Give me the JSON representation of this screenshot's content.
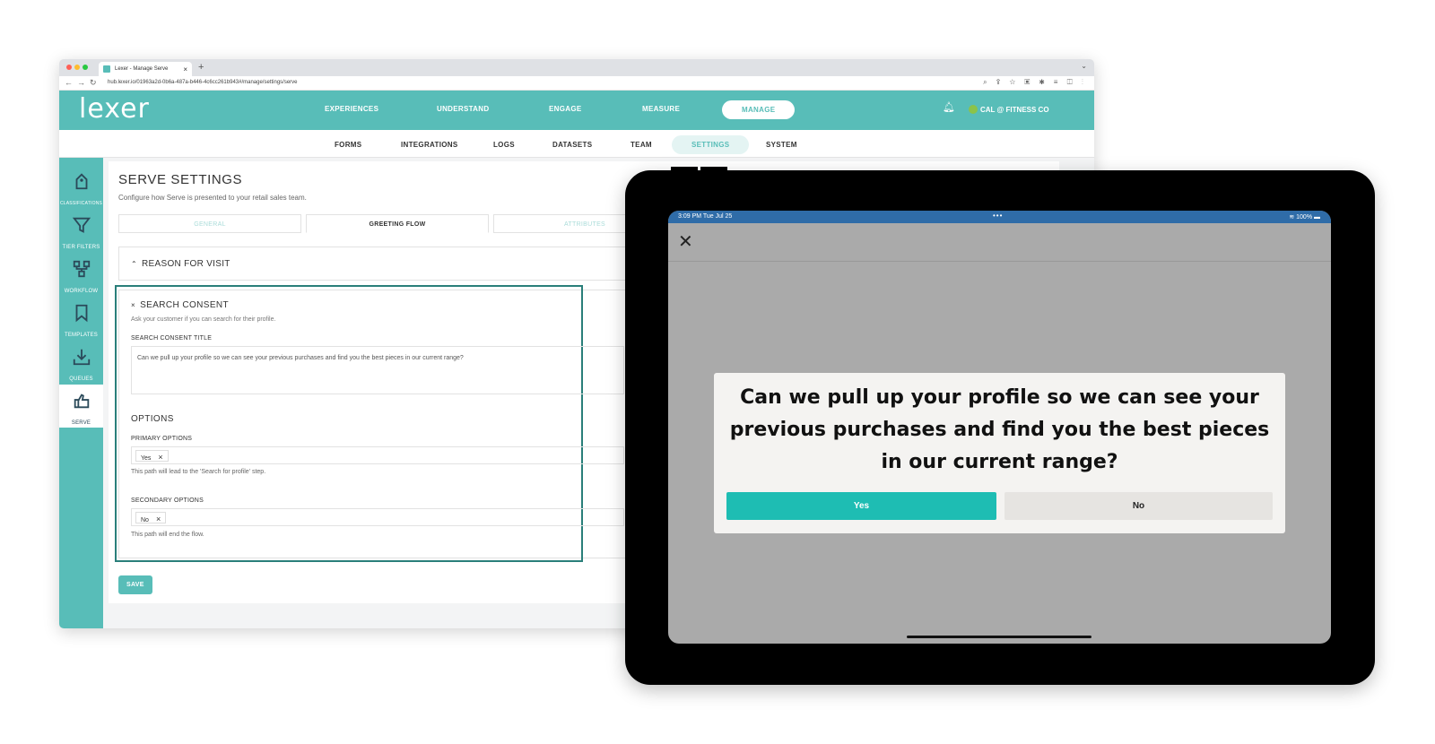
{
  "browser": {
    "tab_title": "Lexer - Manage Serve",
    "url": "hub.lexer.io/01963a2d-0b6a-487a-b446-4c6cc261b943#/manage/settings/serve"
  },
  "app": {
    "logo": "lexer",
    "main_nav": [
      "EXPERIENCES",
      "UNDERSTAND",
      "ENGAGE",
      "MEASURE",
      "MANAGE"
    ],
    "org_name": "CAL @ FITNESS CO",
    "sub_nav": [
      "FORMS",
      "INTEGRATIONS",
      "LOGS",
      "DATASETS",
      "TEAM",
      "SETTINGS",
      "SYSTEM"
    ]
  },
  "sidebar": {
    "items": [
      {
        "label": "CLASSIFICATIONS",
        "icon": "tag-icon"
      },
      {
        "label": "TIER FILTERS",
        "icon": "filter-icon"
      },
      {
        "label": "WORKFLOW",
        "icon": "workflow-icon"
      },
      {
        "label": "TEMPLATES",
        "icon": "bookmark-icon"
      },
      {
        "label": "QUEUES",
        "icon": "download-tray-icon"
      },
      {
        "label": "SERVE",
        "icon": "serve-icon"
      }
    ]
  },
  "page": {
    "title": "SERVE SETTINGS",
    "description": "Configure how Serve is presented to your retail sales team.",
    "tabs": [
      "GENERAL",
      "GREETING FLOW",
      "ATTRIBUTES"
    ],
    "section_reason": "REASON FOR VISIT",
    "save_label": "SAVE"
  },
  "consent": {
    "title": "SEARCH CONSENT",
    "description": "Ask your customer if you can search for their profile.",
    "title_label": "SEARCH CONSENT TITLE",
    "title_value": "Can we pull up your profile so we can see your previous purchases and find you the best pieces in our current range?",
    "options_heading": "OPTIONS",
    "primary_label": "PRIMARY OPTIONS",
    "primary_chip": "Yes",
    "primary_help": "This path will lead to the 'Search for profile' step.",
    "secondary_label": "SECONDARY OPTIONS",
    "secondary_chip": "No",
    "secondary_help": "This path will end the flow."
  },
  "tablet": {
    "time": "3:09 PM   Tue Jul 25",
    "battery": "100%",
    "question": "Can we pull up your profile so we can see your previous purchases and find you the best pieces in our current range?",
    "yes_label": "Yes",
    "no_label": "No"
  },
  "colors": {
    "brand_teal": "#58bdb8",
    "button_teal": "#1ebdb3",
    "highlight_border": "#2a7f7a"
  }
}
